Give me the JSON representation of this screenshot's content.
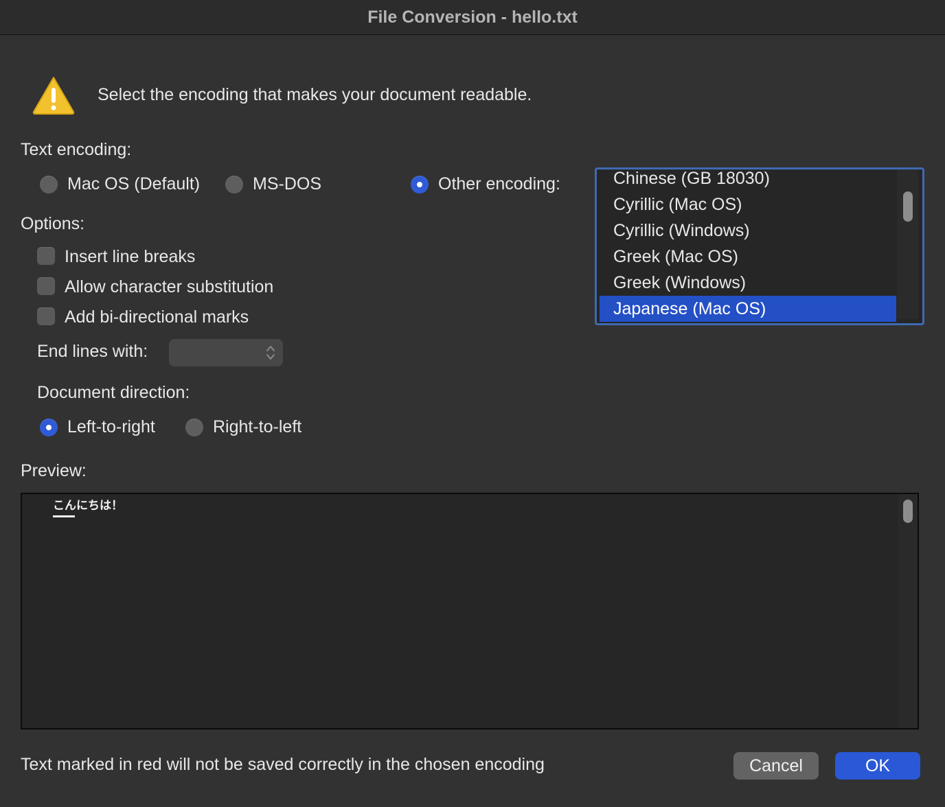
{
  "window": {
    "title": "File Conversion - hello.txt"
  },
  "message": "Select the encoding that makes your document readable.",
  "text_encoding": {
    "label": "Text encoding:",
    "options": [
      "Mac OS (Default)",
      "MS-DOS",
      "Other encoding:"
    ],
    "selected": "Other encoding:"
  },
  "encoding_list": {
    "items": [
      "Chinese (GB 18030)",
      "Cyrillic (Mac OS)",
      "Cyrillic (Windows)",
      "Greek (Mac OS)",
      "Greek (Windows)",
      "Japanese (Mac OS)"
    ],
    "selected": "Japanese (Mac OS)"
  },
  "options": {
    "label": "Options:",
    "checkboxes": [
      {
        "label": "Insert line breaks",
        "checked": false
      },
      {
        "label": "Allow character substitution",
        "checked": false
      },
      {
        "label": "Add bi-directional marks",
        "checked": false
      }
    ],
    "end_lines_label": "End lines with:",
    "end_lines_value": ""
  },
  "direction": {
    "label": "Document direction:",
    "options": [
      "Left-to-right",
      "Right-to-left"
    ],
    "selected": "Left-to-right"
  },
  "preview": {
    "label": "Preview:",
    "content": "こんにちは！"
  },
  "footer": {
    "note": "Text marked in red will not be saved correctly in the chosen encoding",
    "cancel": "Cancel",
    "ok": "OK"
  },
  "colors": {
    "accent": "#2a58d6",
    "list_selection": "#2450c6",
    "list_border": "#3f6ab3",
    "warning": "#f2c12e"
  }
}
